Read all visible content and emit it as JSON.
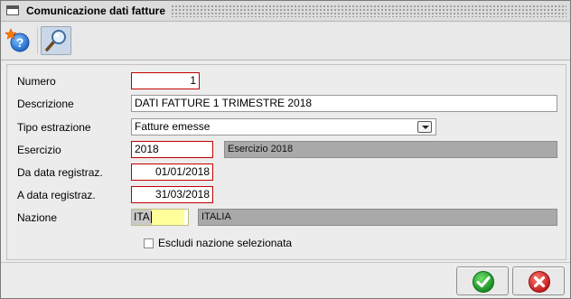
{
  "window": {
    "title": "Comunicazione dati fatture"
  },
  "toolbar": {
    "buttons": [
      {
        "name": "help",
        "icon": "help-star-icon"
      },
      {
        "name": "search",
        "icon": "magnifier-icon",
        "active": true
      }
    ]
  },
  "form": {
    "numero": {
      "label": "Numero",
      "value": "1"
    },
    "descrizione": {
      "label": "Descrizione",
      "value": "DATI FATTURE 1 TRIMESTRE 2018"
    },
    "tipo_estrazione": {
      "label": "Tipo estrazione",
      "value": "Fatture emesse"
    },
    "esercizio": {
      "label": "Esercizio",
      "value": "2018",
      "description": "Esercizio 2018"
    },
    "da_data": {
      "label": "Da data registraz.",
      "value": "01/01/2018"
    },
    "a_data": {
      "label": "A data registraz.",
      "value": "31/03/2018"
    },
    "nazione": {
      "label": "Nazione",
      "value": "ITA",
      "description": "ITALIA"
    },
    "escludi": {
      "label": "Escludi nazione selezionata",
      "checked": false
    }
  },
  "buttons": {
    "ok": {
      "icon": "check-icon"
    },
    "cancel": {
      "icon": "close-icon"
    }
  },
  "colors": {
    "required_border": "#c00000",
    "readonly_bg": "#a9a9a9",
    "focus_bg": "#ffff99",
    "ok_green": "#1f9a2a",
    "cancel_red": "#d8262a"
  }
}
